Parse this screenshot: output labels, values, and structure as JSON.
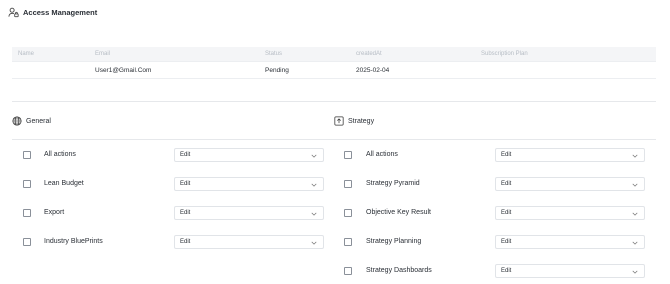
{
  "page": {
    "title": "Access Management",
    "icon": "user-lock-icon"
  },
  "users_table": {
    "columns": [
      "Name",
      "Email",
      "Status",
      "createdAt",
      "Subscription Plan"
    ],
    "rows": [
      {
        "name": "",
        "email": "User1@Gmail.Com",
        "status": "Pending",
        "created_at": "2025-02-04",
        "plan": ""
      }
    ]
  },
  "general": {
    "title": "General",
    "icon": "globe-icon",
    "items": [
      {
        "label": "All actions",
        "value": "Edit"
      },
      {
        "label": "Lean Budget",
        "value": "Edit"
      },
      {
        "label": "Export",
        "value": "Edit"
      },
      {
        "label": "Industry BluePrints",
        "value": "Edit"
      }
    ]
  },
  "strategy": {
    "title": "Strategy",
    "icon": "arrow-up-box-icon",
    "items": [
      {
        "label": "All actions",
        "value": "Edit"
      },
      {
        "label": "Strategy Pyramid",
        "value": "Edit"
      },
      {
        "label": "Objective Key Result",
        "value": "Edit"
      },
      {
        "label": "Strategy Planning",
        "value": "Edit"
      },
      {
        "label": "Strategy Dashboards",
        "value": "Edit"
      }
    ]
  }
}
